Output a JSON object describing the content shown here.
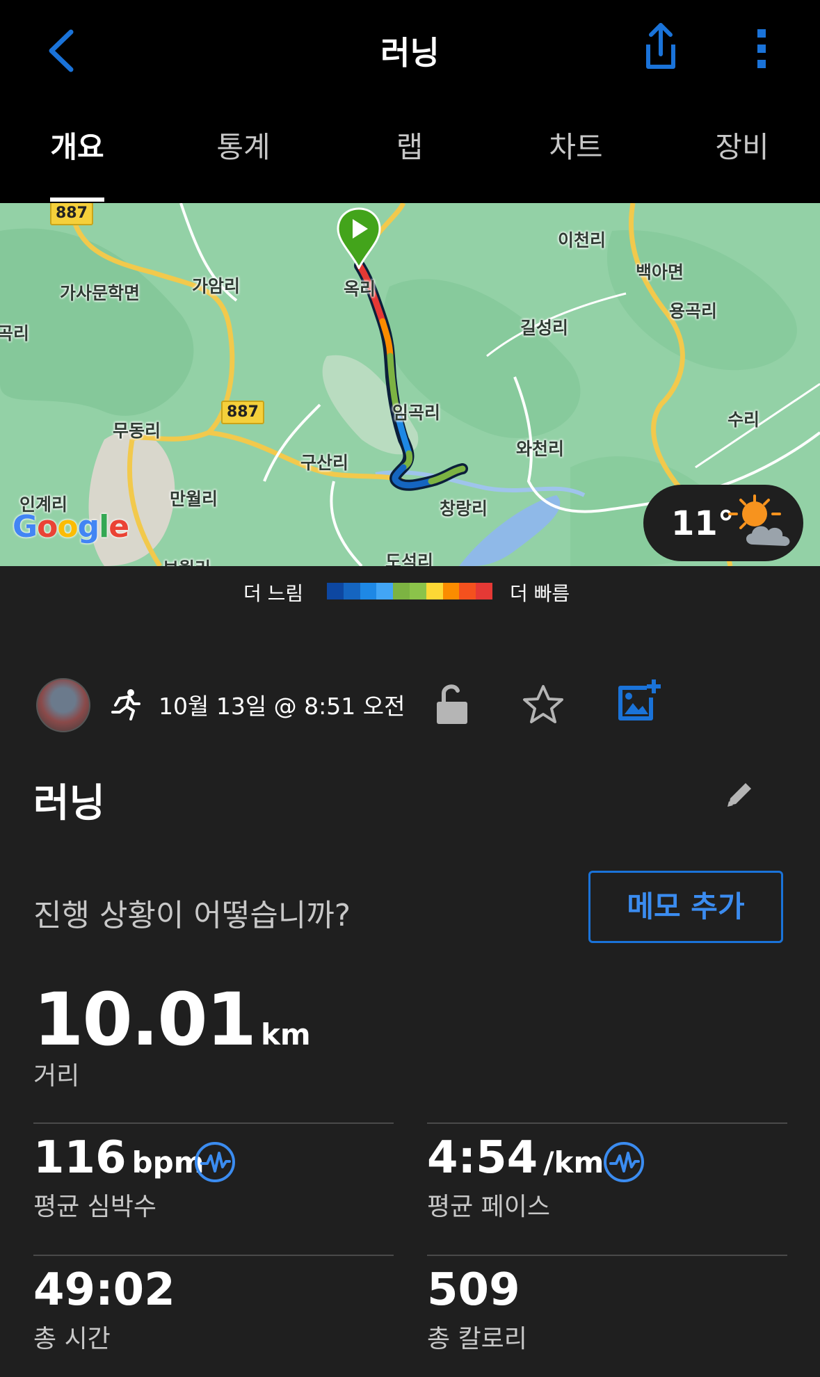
{
  "header": {
    "title": "러닝",
    "back_icon": "chevron-left-icon",
    "share_icon": "share-icon",
    "more_icon": "more-vertical-icon",
    "accent": "#1a73d9"
  },
  "tabs": [
    {
      "label": "개요",
      "active": true
    },
    {
      "label": "통계",
      "active": false
    },
    {
      "label": "랩",
      "active": false
    },
    {
      "label": "차트",
      "active": false
    },
    {
      "label": "장비",
      "active": false
    }
  ],
  "map": {
    "places": [
      "887",
      "가사문학면",
      "가암리",
      "옥리",
      "이천리",
      "백아면",
      "용곡리",
      "길성리",
      "임곡리",
      "무동리",
      "887",
      "구산리",
      "와천리",
      "수리",
      "인계리",
      "만월리",
      "창랑리",
      "도석리",
      "보월리",
      "곡리"
    ],
    "attribution": "Google",
    "weather": {
      "temperature": "11°",
      "icon": "partly-cloudy-sun-icon"
    }
  },
  "pace_legend": {
    "slow_label": "더 느림",
    "fast_label": "더 빠름",
    "colors": [
      "#0d47a1",
      "#1565c0",
      "#1e88e5",
      "#42a5f5",
      "#7cb342",
      "#8bc34a",
      "#fdd835",
      "#fb8c00",
      "#f4511e",
      "#e53935"
    ]
  },
  "activity": {
    "date": "10월 13일 @ 8:51 오전",
    "name": "러닝",
    "question": "진행 상황이 어떻습니까?",
    "memo_button": "메모 추가"
  },
  "stats": {
    "distance": {
      "value": "10.01",
      "unit": "km",
      "label": "거리"
    },
    "avg_hr": {
      "value": "116",
      "unit": "bpm",
      "label": "평균 심박수"
    },
    "avg_pace": {
      "value": "4:54",
      "unit": "/km",
      "label": "평균 페이스"
    },
    "total_time": {
      "value": "49:02",
      "label": "총 시간"
    },
    "total_calories": {
      "value": "509",
      "label": "총 칼로리"
    }
  }
}
